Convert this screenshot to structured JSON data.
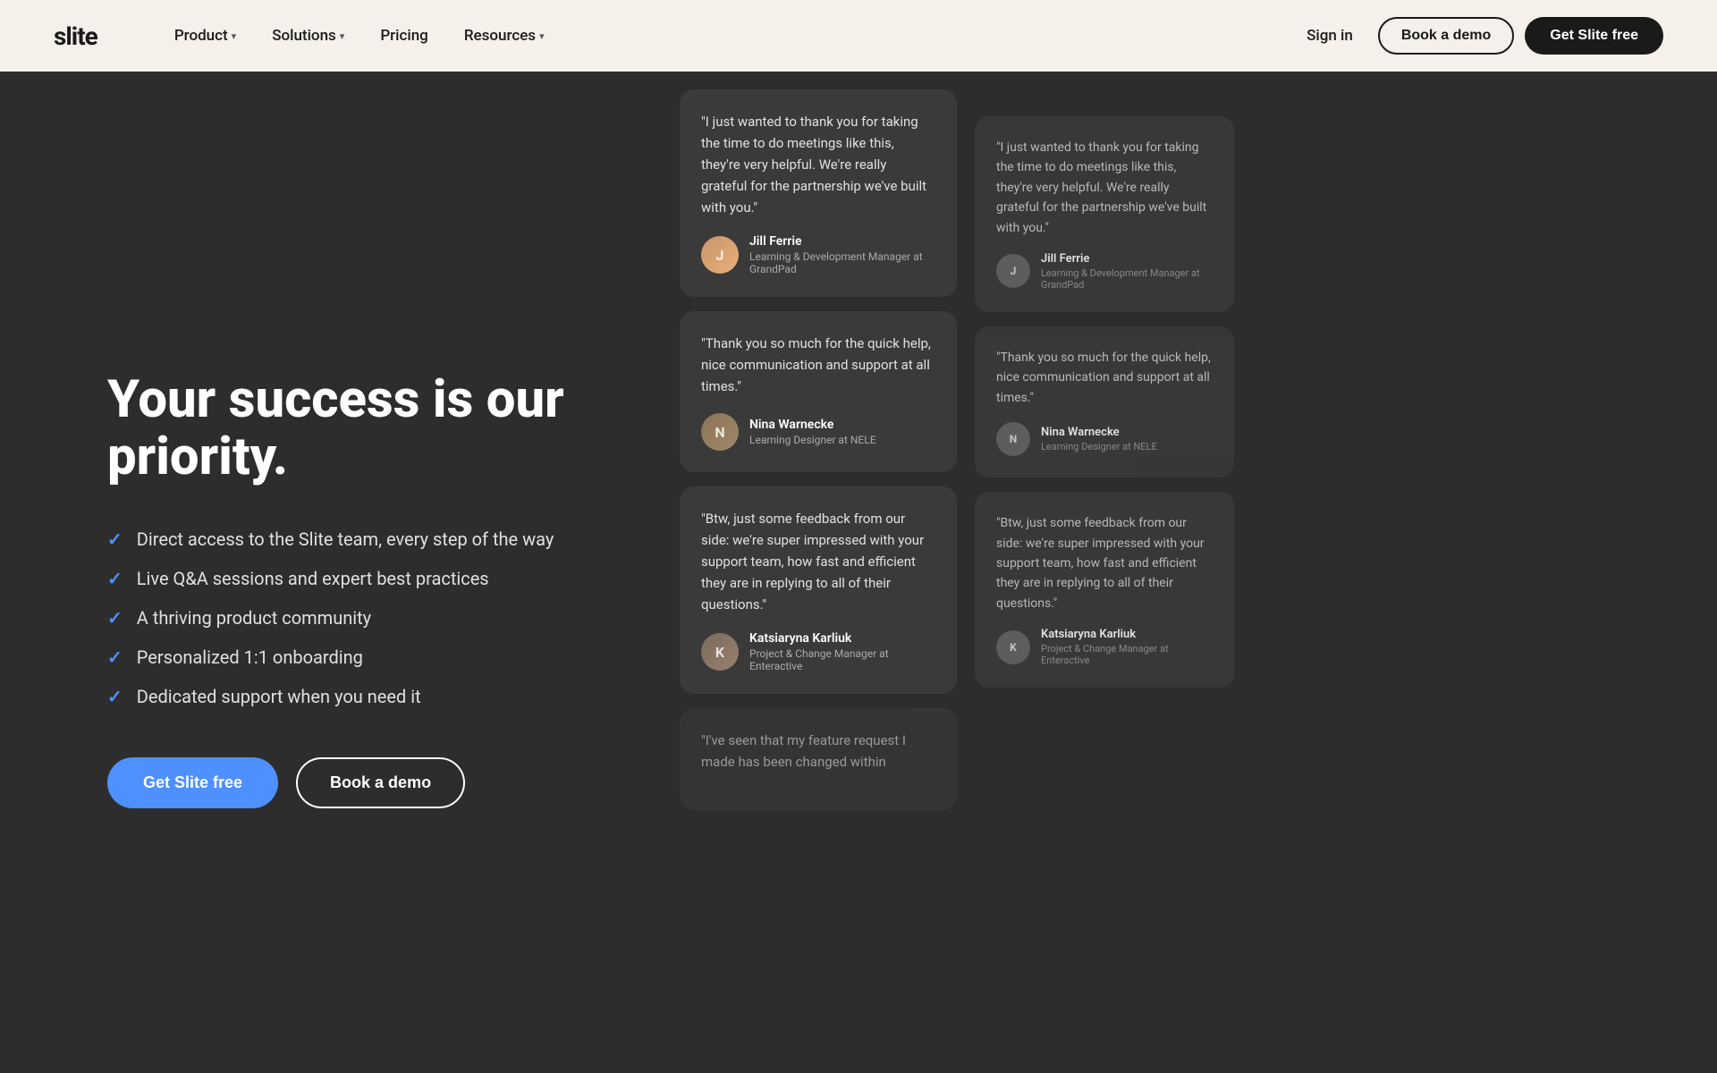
{
  "nav": {
    "logo": "slite",
    "items": [
      {
        "label": "Product",
        "has_dropdown": true
      },
      {
        "label": "Solutions",
        "has_dropdown": true
      },
      {
        "label": "Pricing",
        "has_dropdown": false
      },
      {
        "label": "Resources",
        "has_dropdown": true
      }
    ],
    "signin_label": "Sign in",
    "book_demo_label": "Book a demo",
    "get_free_label": "Get Slite free"
  },
  "hero": {
    "heading": "Your success is our priority.",
    "features": [
      "Direct access to the Slite team, every step of the way",
      "Live Q&A sessions and expert best practices",
      "A thriving product community",
      "Personalized 1:1 onboarding",
      "Dedicated support when you need it"
    ],
    "cta_primary": "Get Slite free",
    "cta_secondary": "Book a demo"
  },
  "testimonials": {
    "col1": [
      {
        "text": "\"I just wanted to thank you for taking the time to do meetings like this, they're very helpful. We're really grateful for the partnership we've built with you.\"",
        "author_name": "Jill Ferrie",
        "author_role": "Learning & Development Manager at GrandPad",
        "avatar_initial": "J",
        "avatar_type": "jill"
      },
      {
        "text": "\"Thank you so much for the quick help, nice communication and support at all times.\"",
        "author_name": "Nina Warnecke",
        "author_role": "Learning Designer at NELE",
        "avatar_initial": "N",
        "avatar_type": "nina"
      },
      {
        "text": "\"Btw, just some feedback from our side: we're super impressed with your support team, how fast and efficient they are in replying to all of their questions.\"",
        "author_name": "Katsiaryna Karliuk",
        "author_role": "Project & Change Manager at Enteractive",
        "avatar_initial": "K",
        "avatar_type": "kat"
      },
      {
        "text": "\"I've seen that my feature request I made has been changed within",
        "author_name": "",
        "author_role": "",
        "avatar_initial": "",
        "avatar_type": ""
      }
    ],
    "col2": [
      {
        "text": "\"I just wanted to thank you for taking the time to do meetings like this, they're very helpful. We're really grateful for the partnership we've built with you.\"",
        "author_name": "Jill Ferrie",
        "author_role": "Learning & Development Manager at GrandPad",
        "avatar_initial": "J",
        "avatar_type": "jill"
      },
      {
        "text": "\"Thank you so much for the quick help, nice communication and support at all times.\"",
        "author_name": "Nina Warnecke",
        "author_role": "Learning Designer at NELE",
        "avatar_initial": "N",
        "avatar_type": "nina"
      },
      {
        "text": "\"Btw, just some feedback from our side: we're super impressed with your support team, how fast and efficient they are in replying to all of their questions.\"",
        "author_name": "Katsiaryna Karliuk",
        "author_role": "Project & Change Manager at Enteractive",
        "avatar_initial": "K",
        "avatar_type": "kat"
      }
    ]
  }
}
